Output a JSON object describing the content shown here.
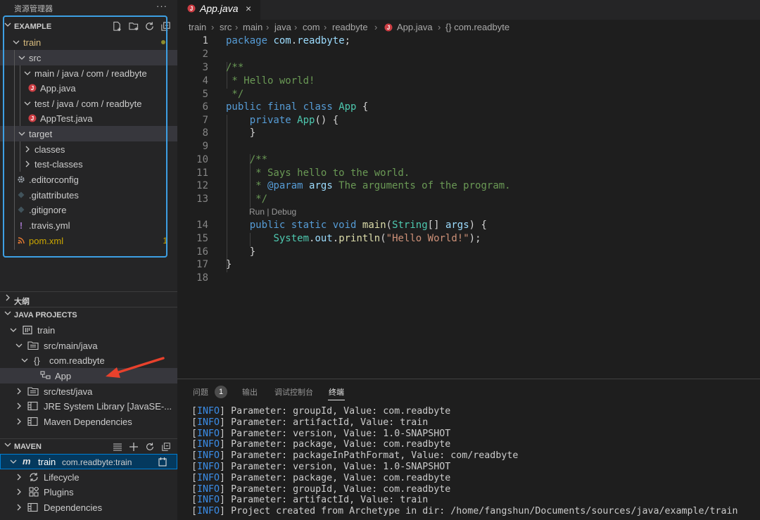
{
  "sidebar": {
    "title": "资源管理器",
    "more": "···",
    "explorer": {
      "header": "EXAMPLE",
      "items": [
        {
          "label": "train",
          "modified_dot": true
        },
        {
          "label": "src"
        },
        {
          "label": "main / java / com / readbyte"
        },
        {
          "label": "App.java"
        },
        {
          "label": "test / java / com / readbyte"
        },
        {
          "label": "AppTest.java"
        },
        {
          "label": "target"
        },
        {
          "label": "classes"
        },
        {
          "label": "test-classes"
        },
        {
          "label": ".editorconfig"
        },
        {
          "label": ".gitattributes"
        },
        {
          "label": ".gitignore"
        },
        {
          "label": ".travis.yml"
        },
        {
          "label": "pom.xml",
          "count": "1"
        }
      ]
    },
    "outline": {
      "header": "大纲"
    },
    "java_projects": {
      "header": "JAVA PROJECTS",
      "items": [
        {
          "label": "train"
        },
        {
          "label": "src/main/java"
        },
        {
          "label": "com.readbyte",
          "prefix": "{}"
        },
        {
          "label": "App"
        },
        {
          "label": "src/test/java"
        },
        {
          "label": "JRE System Library [JavaSE-..."
        },
        {
          "label": "Maven Dependencies"
        }
      ]
    },
    "maven": {
      "header": "MAVEN",
      "items": [
        {
          "label": "train",
          "detail": "com.readbyte:train"
        },
        {
          "label": "Lifecycle"
        },
        {
          "label": "Plugins"
        },
        {
          "label": "Dependencies"
        }
      ]
    }
  },
  "editor": {
    "tab": {
      "name": "App.java",
      "close": "×"
    },
    "breadcrumb": [
      "train",
      "src",
      "main",
      "java",
      "com",
      "readbyte",
      "App.java",
      "{} com.readbyte"
    ],
    "codelens": "Run | Debug",
    "line_numbers": [
      "1",
      "2",
      "3",
      "4",
      "5",
      "6",
      "7",
      "8",
      "9",
      "10",
      "11",
      "12",
      "13",
      "14",
      "15",
      "16",
      "17",
      "18"
    ],
    "lines": [
      {
        "n": "1",
        "code": "package com.readbyte;"
      },
      {
        "n": "2",
        "code": ""
      },
      {
        "n": "3",
        "code": "/**"
      },
      {
        "n": "4",
        "code": " * Hello world!"
      },
      {
        "n": "5",
        "code": " */"
      },
      {
        "n": "6",
        "code": "public final class App {"
      },
      {
        "n": "7",
        "code": "    private App() {"
      },
      {
        "n": "8",
        "code": "    }"
      },
      {
        "n": "9",
        "code": ""
      },
      {
        "n": "10",
        "code": "    /**"
      },
      {
        "n": "11",
        "code": "     * Says hello to the world."
      },
      {
        "n": "12",
        "code": "     * @param args The arguments of the program."
      },
      {
        "n": "13",
        "code": "     */"
      },
      {
        "n": "14",
        "code": "    public static void main(String[] args) {"
      },
      {
        "n": "15",
        "code": "        System.out.println(\"Hello World!\");"
      },
      {
        "n": "16",
        "code": "    }"
      },
      {
        "n": "17",
        "code": "}"
      },
      {
        "n": "18",
        "code": ""
      }
    ]
  },
  "panel": {
    "tabs": [
      {
        "label": "问题",
        "count": "1"
      },
      {
        "label": "输出"
      },
      {
        "label": "调试控制台"
      },
      {
        "label": "终端",
        "active": true
      }
    ],
    "terminal_tag": "[INFO]",
    "terminal_lines": [
      "Parameter: groupId, Value: com.readbyte",
      "Parameter: artifactId, Value: train",
      "Parameter: version, Value: 1.0-SNAPSHOT",
      "Parameter: package, Value: com.readbyte",
      "Parameter: packageInPathFormat, Value: com/readbyte",
      "Parameter: version, Value: 1.0-SNAPSHOT",
      "Parameter: package, Value: com.readbyte",
      "Parameter: groupId, Value: com.readbyte",
      "Parameter: artifactId, Value: train",
      "Project created from Archetype in dir: /home/fangshun/Documents/sources/java/example/train"
    ]
  },
  "colors": {
    "accent": "#007fd4",
    "annotation_box": "#3d9fe3",
    "annotation_arrow": "#e8412c",
    "java_icon": "#cc3e44"
  },
  "icons": [
    "new-file-icon",
    "new-folder-icon",
    "refresh-icon",
    "collapse-all-icon",
    "java-file-icon",
    "gear-icon",
    "git-icon",
    "yaml-icon",
    "xml-icon",
    "package-icon",
    "class-icon",
    "library-icon",
    "maven-icon",
    "lifecycle-icon",
    "plugins-icon",
    "list-icon",
    "add-icon",
    "terminal-icon"
  ]
}
